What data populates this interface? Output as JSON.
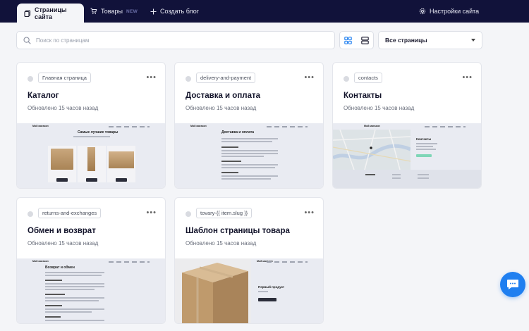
{
  "nav": {
    "tabs": [
      {
        "label": "Страницы сайта",
        "icon": "pages-icon"
      },
      {
        "label": "Товары",
        "badge": "NEW",
        "icon": "cart-icon"
      },
      {
        "label": "Создать блог",
        "icon": "plus-icon"
      }
    ],
    "settings_label": "Настройки сайта",
    "colors": {
      "bar": "#11123a",
      "accent": "#1f7ff0"
    }
  },
  "toolbar": {
    "search_placeholder": "Поиск по страницам",
    "filter_value": "Все страницы"
  },
  "cards": [
    {
      "slug": "Главная страница",
      "title": "Каталог",
      "updated": "Обновлено 15 часов назад",
      "preview": "catalog"
    },
    {
      "slug": "delivery-and-payment",
      "title": "Доставка и оплата",
      "updated": "Обновлено 15 часов назад",
      "preview": "delivery"
    },
    {
      "slug": "contacts",
      "title": "Контакты",
      "updated": "Обновлено 15 часов назад",
      "preview": "contacts"
    },
    {
      "slug": "returns-and-exchanges",
      "title": "Обмен и возврат",
      "updated": "Обновлено 15 часов назад",
      "preview": "returns"
    },
    {
      "slug": "tovary-{{ item.slug }}",
      "title": "Шаблон страницы товара",
      "updated": "Обновлено 15 часов назад",
      "preview": "product"
    }
  ],
  "previews": {
    "logo": "Мой магазин",
    "catalog_heading": "Самые лучшие товары",
    "delivery_heading": "Доставка и оплата",
    "contacts_heading": "Контакты",
    "returns_heading": "Возврат и обмен",
    "product_heading": "Первый продукт"
  }
}
